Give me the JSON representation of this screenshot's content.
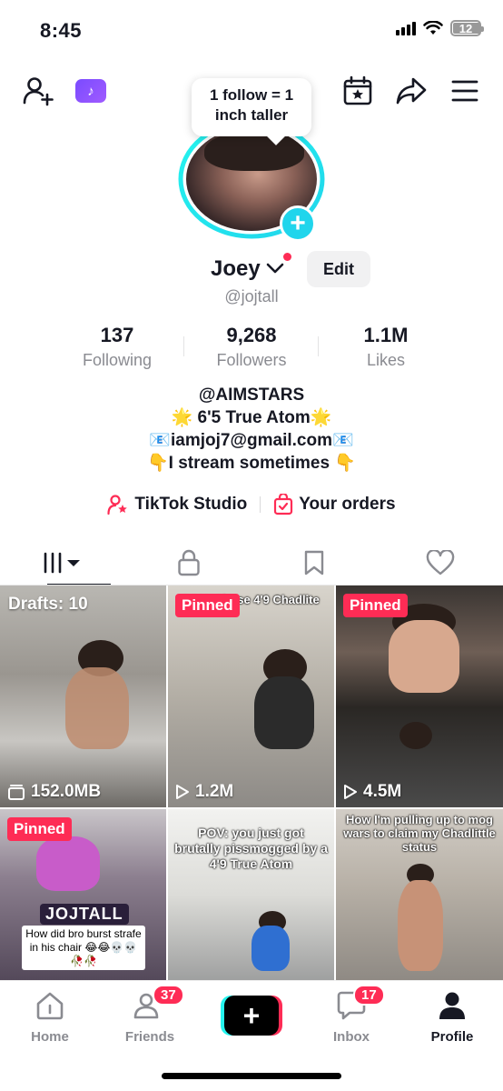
{
  "status_bar": {
    "time": "8:45",
    "battery": "12"
  },
  "top_nav": {
    "app_badge": "♪"
  },
  "tooltip": {
    "line1": "1 follow = 1",
    "line2": "inch taller"
  },
  "profile": {
    "name": "Joey",
    "edit_label": "Edit",
    "handle": "@jojtall",
    "stats": [
      {
        "value": "137",
        "label": "Following"
      },
      {
        "value": "9,268",
        "label": "Followers"
      },
      {
        "value": "1.1M",
        "label": "Likes"
      }
    ],
    "bio": [
      "@AIMSTARS",
      "🌟 6'5 True Atom🌟",
      "📧iamjoj7@gmail.com📧",
      "👇I stream sometimes 👇"
    ]
  },
  "links": {
    "studio": "TikTok Studio",
    "orders": "Your orders"
  },
  "grid": {
    "drafts_label": "Drafts: 10",
    "drafts_size": "152.0MB",
    "pinned_label": "Pinned",
    "video2_caption": "POV: Chose 4'9 Chadlite",
    "video2_views": "1.2M",
    "video3_views": "4.5M",
    "video4_channel": "JOJTALL",
    "video4_caption": "How did bro burst strafe in his chair 😂😂💀💀🥀🥀",
    "video5_caption": "POV: you just got brutally pissmogged by a 4'9 True Atom",
    "video6_caption": "How I'm pulling up to mog wars to claim my Chadlittle status"
  },
  "bottom_nav": {
    "home": "Home",
    "friends": "Friends",
    "friends_badge": "37",
    "inbox": "Inbox",
    "inbox_badge": "17",
    "profile": "Profile"
  },
  "colors": {
    "accent": "#fe2c55",
    "cyan": "#20d5ec",
    "text": "#161823",
    "muted": "#8a8b91"
  }
}
